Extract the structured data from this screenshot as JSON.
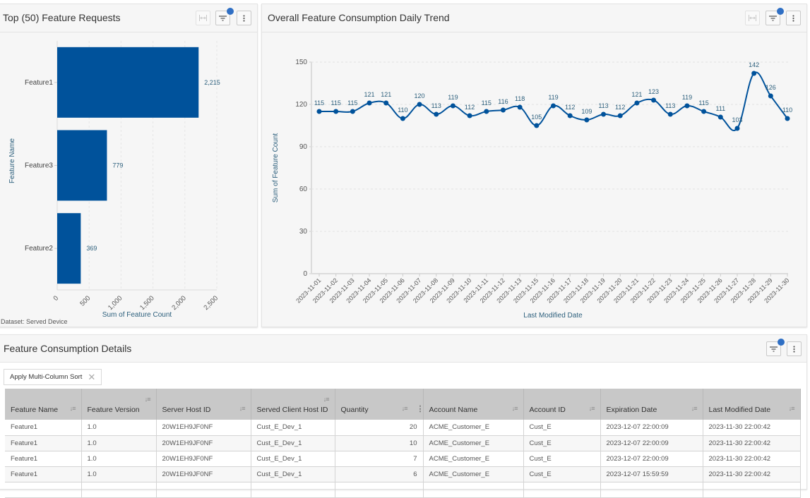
{
  "left_panel": {
    "title": "Top (50) Feature Requests",
    "toolbar": {
      "fit_icon": "fit-width-icon",
      "filter_icon": "filter-icon",
      "menu_icon": "more-vertical-icon",
      "filter_active": true
    },
    "dataset_label": "Dataset: Served Device"
  },
  "right_panel": {
    "title": "Overall Feature Consumption Daily Trend",
    "toolbar": {
      "fit_icon": "fit-width-icon",
      "filter_icon": "filter-icon",
      "menu_icon": "more-vertical-icon",
      "filter_active": true
    }
  },
  "chart_data": [
    {
      "type": "bar",
      "orientation": "horizontal",
      "title": "Top (50) Feature Requests",
      "categories": [
        "Feature1",
        "Feature3",
        "Feature2"
      ],
      "values": [
        2215,
        779,
        369
      ],
      "value_labels": [
        "2,215",
        "779",
        "369"
      ],
      "xlabel": "Sum of Feature Count",
      "ylabel": "Feature Name",
      "xlim": [
        0,
        2500
      ],
      "xticks": [
        0,
        500,
        1000,
        1500,
        2000,
        2500
      ],
      "xtick_labels": [
        "0",
        "500",
        "1,000",
        "1,500",
        "2,000",
        "2,500"
      ],
      "grid": true,
      "color": "#00529b"
    },
    {
      "type": "line",
      "title": "Overall Feature Consumption Daily Trend",
      "x": [
        "2023-11-01",
        "2023-11-02",
        "2023-11-03",
        "2023-11-04",
        "2023-11-05",
        "2023-11-06",
        "2023-11-07",
        "2023-11-08",
        "2023-11-09",
        "2023-11-10",
        "2023-11-11",
        "2023-11-12",
        "2023-11-13",
        "2023-11-15",
        "2023-11-16",
        "2023-11-17",
        "2023-11-18",
        "2023-11-19",
        "2023-11-20",
        "2023-11-21",
        "2023-11-22",
        "2023-11-23",
        "2023-11-24",
        "2023-11-25",
        "2023-11-26",
        "2023-11-27",
        "2023-11-28",
        "2023-11-29",
        "2023-11-30"
      ],
      "values": [
        115,
        115,
        115,
        121,
        121,
        110,
        120,
        113,
        119,
        112,
        115,
        116,
        118,
        105,
        119,
        112,
        109,
        113,
        112,
        121,
        123,
        113,
        119,
        115,
        111,
        103,
        142,
        126,
        110
      ],
      "xlabel": "Last Modified Date",
      "ylabel": "Sum of Feature Count",
      "ylim": [
        0,
        150
      ],
      "yticks": [
        0,
        30,
        60,
        90,
        120,
        150
      ],
      "grid": true,
      "smooth": true,
      "color": "#00529b"
    }
  ],
  "bottom_panel": {
    "title": "Feature Consumption Details",
    "toolbar": {
      "filter_icon": "filter-icon",
      "menu_icon": "more-vertical-icon",
      "filter_active": true
    },
    "sort_chip": {
      "label": "Apply Multi-Column Sort",
      "close_icon": "close-icon"
    },
    "table": {
      "columns": [
        {
          "label": "Feature Name",
          "sort": "unsorted"
        },
        {
          "label": "Feature Version",
          "sort": "unsorted"
        },
        {
          "label": "Server Host ID",
          "sort": "unsorted"
        },
        {
          "label": "Served Client Host ID",
          "sort": "unsorted"
        },
        {
          "label": "Quantity",
          "sort": "unsorted"
        },
        {
          "label": "Account Name",
          "sort": "unsorted"
        },
        {
          "label": "Account ID",
          "sort": "unsorted"
        },
        {
          "label": "Expiration Date",
          "sort": "unsorted"
        },
        {
          "label": "Last Modified Date",
          "sort": "descending"
        }
      ],
      "rows": [
        [
          "Feature1",
          "1.0",
          "20W1EH9JF0NF",
          "Cust_E_Dev_1",
          "20",
          "ACME_Customer_E",
          "Cust_E",
          "2023-12-07 22:00:09",
          "2023-11-30 22:00:42"
        ],
        [
          "Feature1",
          "1.0",
          "20W1EH9JF0NF",
          "Cust_E_Dev_1",
          "10",
          "ACME_Customer_E",
          "Cust_E",
          "2023-12-07 22:00:09",
          "2023-11-30 22:00:42"
        ],
        [
          "Feature1",
          "1.0",
          "20W1EH9JF0NF",
          "Cust_E_Dev_1",
          "7",
          "ACME_Customer_E",
          "Cust_E",
          "2023-12-07 22:00:09",
          "2023-11-30 22:00:42"
        ],
        [
          "Feature1",
          "1.0",
          "20W1EH9JF0NF",
          "Cust_E_Dev_1",
          "6",
          "ACME_Customer_E",
          "Cust_E",
          "2023-12-07 15:59:59",
          "2023-11-30 22:00:42"
        ],
        [
          "",
          "",
          "",
          "",
          "",
          "",
          "",
          "",
          ""
        ]
      ]
    }
  },
  "colors": {
    "accent": "#00529b",
    "badge": "#2f6fc4",
    "axis_title": "#2c5f7c",
    "table_header_bg": "#c8c8c8"
  }
}
